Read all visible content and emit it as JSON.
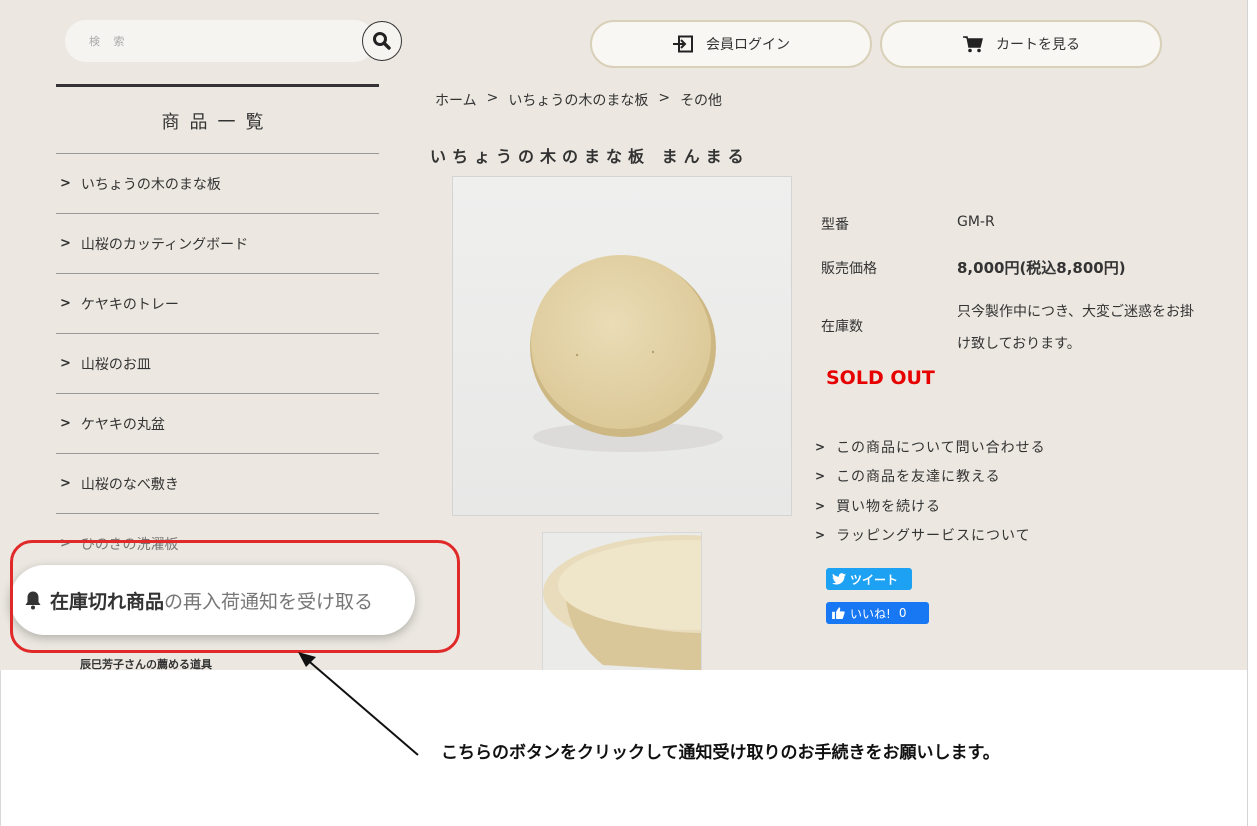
{
  "header": {
    "search_placeholder": "検 索",
    "login_label": "会員ログイン",
    "cart_label": "カートを見る"
  },
  "sidebar": {
    "title": "商品一覧",
    "items": [
      {
        "label": "いちょうの木のまな板"
      },
      {
        "label": "山桜のカッティングボード"
      },
      {
        "label": "ケヤキのトレー"
      },
      {
        "label": "山桜のお皿"
      },
      {
        "label": "ケヤキの丸盆"
      },
      {
        "label": "山桜のなべ敷き"
      },
      {
        "label": "ひのきの洗濯板"
      }
    ],
    "recommend_label": "辰巳芳子さんの薦める道具"
  },
  "notify": {
    "bold_text": "在庫切れ商品",
    "rest_text": "の再入荷通知を受け取る"
  },
  "breadcrumb": {
    "home": "ホーム",
    "category": "いちょうの木のまな板",
    "current": "その他",
    "separator": ">"
  },
  "product": {
    "title": "いちょうの木のまな板 まんまる",
    "model_label": "型番",
    "model_value": "GM-R",
    "price_label": "販売価格",
    "price_value": "8,000円(税込8,800円)",
    "stock_label": "在庫数",
    "stock_value": "只今製作中につき、大変ご迷惑をお掛け致しております。",
    "sold_out": "SOLD OUT"
  },
  "links": [
    {
      "label": "この商品について問い合わせる"
    },
    {
      "label": "この商品を友達に教える"
    },
    {
      "label": "買い物を続ける"
    },
    {
      "label": "ラッピングサービスについて"
    }
  ],
  "social": {
    "tweet_label": "ツイート",
    "like_label": "いいね!",
    "like_count": "0"
  },
  "annotation": {
    "instruction": "こちらのボタンをクリックして通知受け取りのお手続きをお願いします。"
  },
  "colors": {
    "page_bg": "#ece8e1",
    "sold_out": "#e60000",
    "highlight_frame": "#e02a2a",
    "tweet": "#1da1f2",
    "like": "#1877f2"
  }
}
